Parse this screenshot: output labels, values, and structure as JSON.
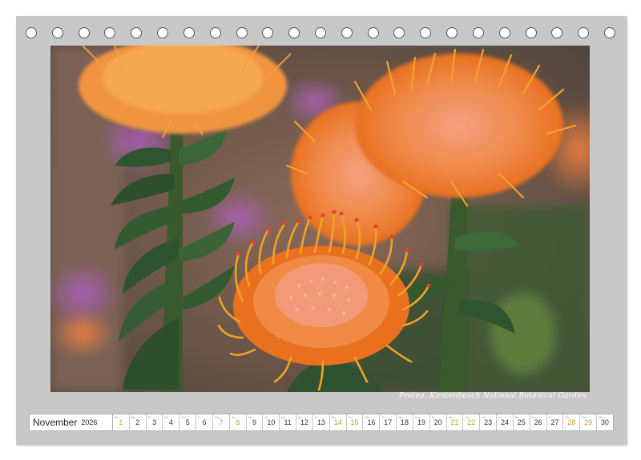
{
  "caption": "Protea, Kirstenbosch National Botanical Garden",
  "month": {
    "name": "November",
    "year": "2026"
  },
  "colors": {
    "frame": "#c8c8c8",
    "weekend": "#c89a2a",
    "text": "#333333"
  },
  "days": [
    {
      "n": "1",
      "d": "So",
      "weekend": true
    },
    {
      "n": "2",
      "d": "Mo",
      "weekend": false
    },
    {
      "n": "3",
      "d": "Di",
      "weekend": false
    },
    {
      "n": "4",
      "d": "Mi",
      "weekend": false
    },
    {
      "n": "5",
      "d": "Do",
      "weekend": false
    },
    {
      "n": "6",
      "d": "Fr",
      "weekend": false
    },
    {
      "n": "7",
      "d": "Sa",
      "weekend": true
    },
    {
      "n": "8",
      "d": "So",
      "weekend": true
    },
    {
      "n": "9",
      "d": "Mo",
      "weekend": false
    },
    {
      "n": "10",
      "d": "Di",
      "weekend": false
    },
    {
      "n": "11",
      "d": "Mi",
      "weekend": false
    },
    {
      "n": "12",
      "d": "Do",
      "weekend": false
    },
    {
      "n": "13",
      "d": "Fr",
      "weekend": false
    },
    {
      "n": "14",
      "d": "Sa",
      "weekend": true
    },
    {
      "n": "15",
      "d": "So",
      "weekend": true
    },
    {
      "n": "16",
      "d": "Mo",
      "weekend": false
    },
    {
      "n": "17",
      "d": "Di",
      "weekend": false
    },
    {
      "n": "18",
      "d": "Mi",
      "weekend": false
    },
    {
      "n": "19",
      "d": "Do",
      "weekend": false
    },
    {
      "n": "20",
      "d": "Fr",
      "weekend": false
    },
    {
      "n": "21",
      "d": "Sa",
      "weekend": true
    },
    {
      "n": "22",
      "d": "So",
      "weekend": true
    },
    {
      "n": "23",
      "d": "Mo",
      "weekend": false
    },
    {
      "n": "24",
      "d": "Di",
      "weekend": false
    },
    {
      "n": "25",
      "d": "Mi",
      "weekend": false
    },
    {
      "n": "26",
      "d": "Do",
      "weekend": false
    },
    {
      "n": "27",
      "d": "Fr",
      "weekend": false
    },
    {
      "n": "28",
      "d": "Sa",
      "weekend": true
    },
    {
      "n": "29",
      "d": "So",
      "weekend": true
    },
    {
      "n": "30",
      "d": "Mo",
      "weekend": false
    }
  ]
}
